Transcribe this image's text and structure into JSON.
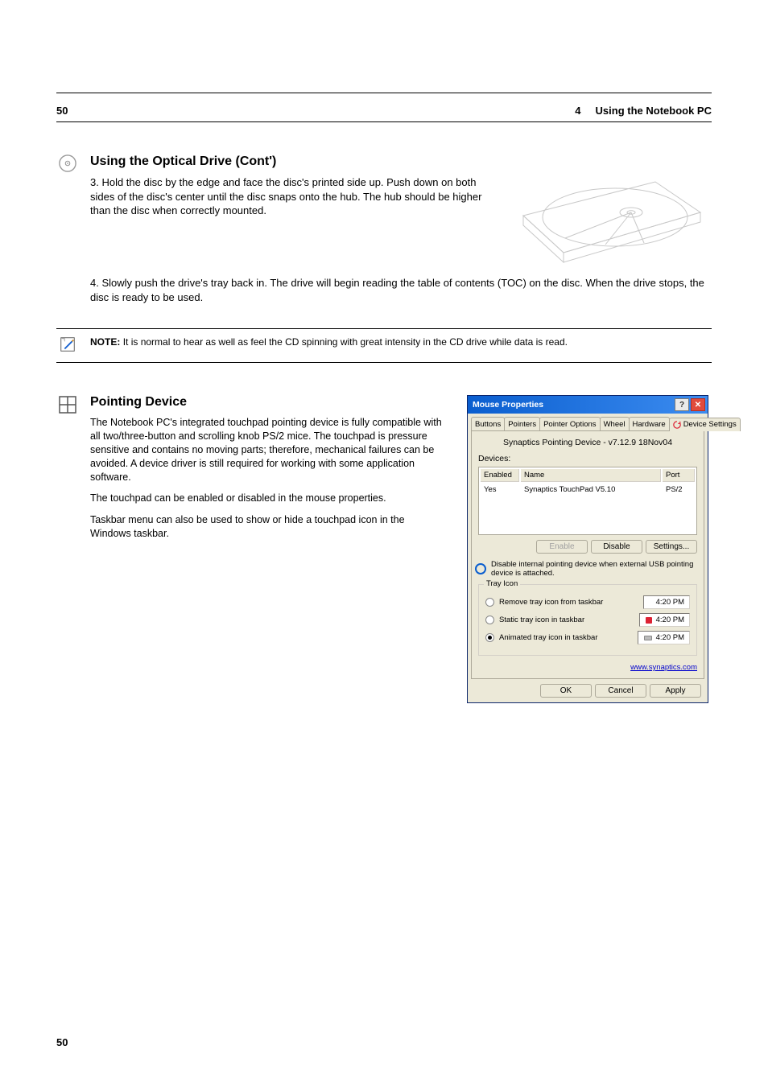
{
  "header": {
    "page_label": "50",
    "chapter": "4",
    "chapter_title": "Using the Notebook PC"
  },
  "sections": {
    "optical_drive": {
      "heading": "Using the Optical Drive (Cont')",
      "p1": "3.    Hold the disc by the edge and face the disc's printed side up. Push down on both sides of the disc's center until the disc snaps onto the hub. The hub should be higher than the disc when correctly mounted.",
      "p2": "4.    Slowly push the drive's tray back in. The drive will begin reading the table of contents (TOC) on the disc. When the drive stops, the disc is ready to be used."
    },
    "note": {
      "label": "NOTE:",
      "text": "It is normal to hear as well as feel the CD spinning with great intensity in the CD drive while data is read."
    },
    "touchpad": {
      "heading": "Pointing Device",
      "p1": "The Notebook PC's integrated touchpad pointing device is fully compatible with all two/three-button and scrolling knob PS/2 mice. The touchpad is pressure sensitive and contains no moving parts; therefore, mechanical failures can be avoided. A device driver is still required for working with some application software.",
      "p2": "The touchpad can be enabled or disabled in the mouse properties.",
      "p3": "Taskbar menu can also be used to show or hide a touchpad icon in the Windows taskbar."
    }
  },
  "dialog": {
    "title": "Mouse Properties",
    "tabs": [
      "Buttons",
      "Pointers",
      "Pointer Options",
      "Wheel",
      "Hardware",
      "Device Settings"
    ],
    "active_tab_index": 5,
    "panel": {
      "driver_line": "Synaptics Pointing Device - v7.12.9 18Nov04",
      "devices_label": "Devices:",
      "columns": [
        "Enabled",
        "Name",
        "Port"
      ],
      "row": {
        "enabled": "Yes",
        "name": "Synaptics TouchPad V5.10",
        "port": "PS/2"
      },
      "buttons": {
        "enable": "Enable",
        "disable": "Disable",
        "settings": "Settings..."
      },
      "checkbox_text": "Disable internal pointing device when external USB pointing device is attached.",
      "tray_legend": "Tray Icon",
      "tray_options": {
        "remove": "Remove tray icon from taskbar",
        "static": "Static tray icon in taskbar",
        "animated": "Animated tray icon in taskbar"
      },
      "tray_time": "4:20 PM",
      "link": "www.synaptics.com"
    },
    "footer": {
      "ok": "OK",
      "cancel": "Cancel",
      "apply": "Apply"
    }
  },
  "footer_page": "50"
}
